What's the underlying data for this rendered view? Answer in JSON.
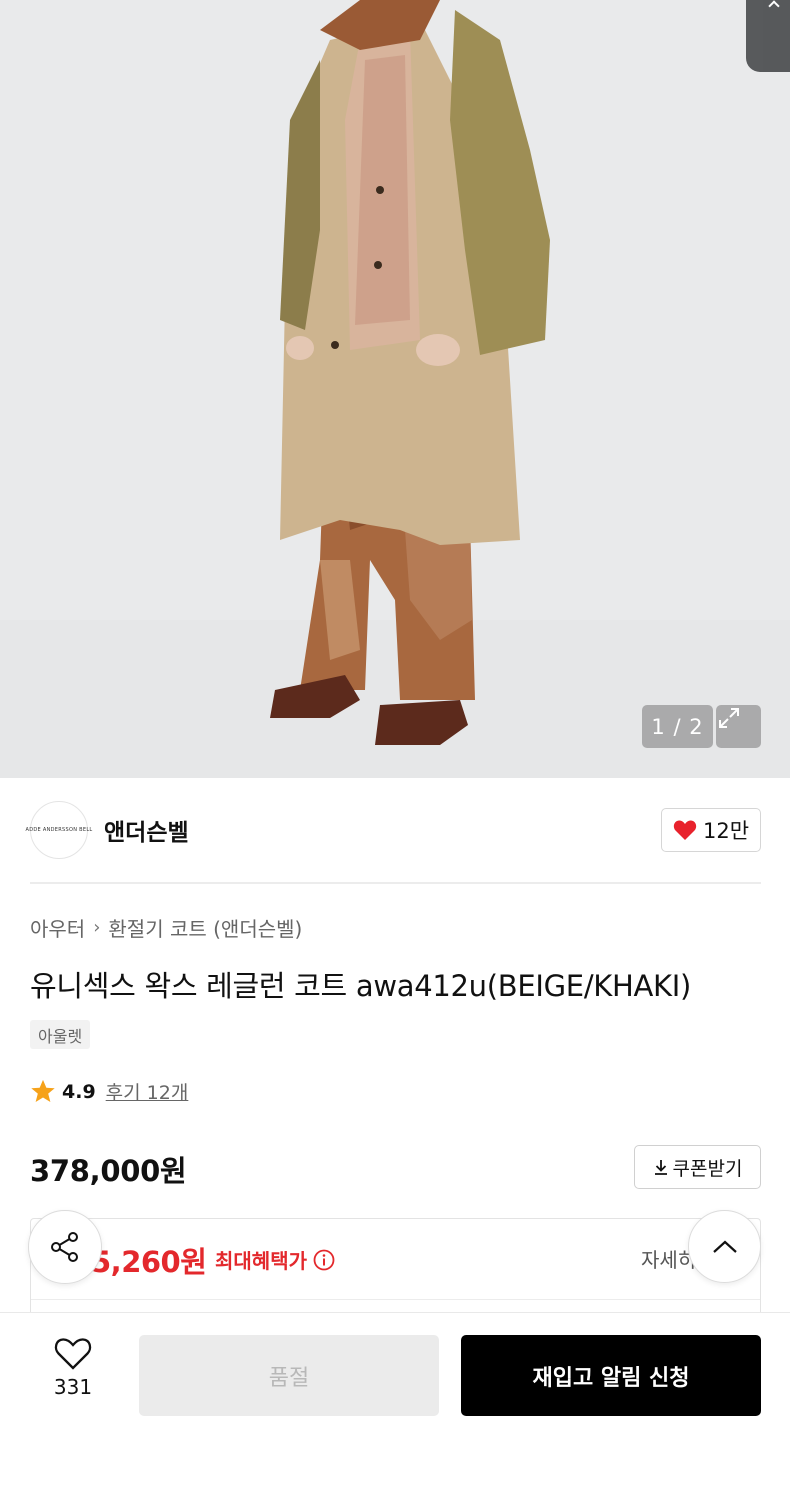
{
  "colors": {
    "accent_red": "#e3282c",
    "heart_red": "#e8222c",
    "star": "#f6a21a",
    "primary_button": "#000000",
    "disabled_button": "#ebebeb"
  },
  "gallery": {
    "counter": "1 / 2",
    "expand_icon": "expand-icon"
  },
  "brand": {
    "logo_text": "ADDE ANDERSSON BELL",
    "name": "앤더슨벨",
    "likes": "12만"
  },
  "product": {
    "breadcrumb": [
      "아우터",
      "환절기 코트 (앤더슨벨)"
    ],
    "title": "유니섹스 왁스 레글런 코트 awa412u(BEIGE/KHAKI)",
    "tag": "아울렛",
    "rating": "4.9",
    "reviews": "후기 12개",
    "price": "378,000원",
    "coupon_label": "쿠폰받기"
  },
  "benefit": {
    "price": "5,260원",
    "label": "최대혜택가",
    "detail": "자세히"
  },
  "bottom_bar": {
    "wish_count": "331",
    "soldout_label": "품절",
    "restock_label": "재입고 알림 신청"
  }
}
